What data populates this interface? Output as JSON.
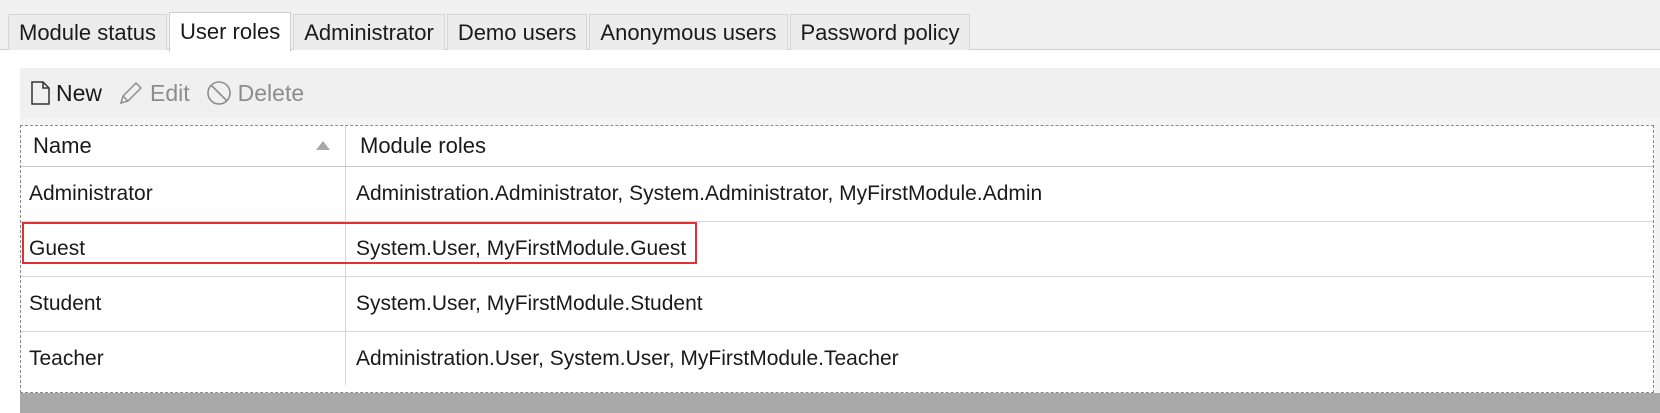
{
  "tabs": [
    {
      "label": "Module status",
      "active": false
    },
    {
      "label": "User roles",
      "active": true
    },
    {
      "label": "Administrator",
      "active": false
    },
    {
      "label": "Demo users",
      "active": false
    },
    {
      "label": "Anonymous users",
      "active": false
    },
    {
      "label": "Password policy",
      "active": false
    }
  ],
  "toolbar": {
    "new_label": "New",
    "edit_label": "Edit",
    "delete_label": "Delete",
    "new_icon": "new-document-icon",
    "edit_icon": "pencil-icon",
    "delete_icon": "prohibited-icon"
  },
  "grid": {
    "columns": [
      "Name",
      "Module roles"
    ],
    "sort_column": "Name",
    "sort_direction": "ascending",
    "rows": [
      {
        "name": "Administrator",
        "roles": "Administration.Administrator, System.Administrator, MyFirstModule.Admin"
      },
      {
        "name": "Guest",
        "roles": "System.User, MyFirstModule.Guest"
      },
      {
        "name": "Student",
        "roles": "System.User, MyFirstModule.Student"
      },
      {
        "name": "Teacher",
        "roles": "Administration.User, System.User, MyFirstModule.Teacher"
      }
    ]
  },
  "colors": {
    "highlight": "#e03131",
    "selected_border": "#8a8a8a",
    "disabled_text": "#8d8d8d"
  }
}
